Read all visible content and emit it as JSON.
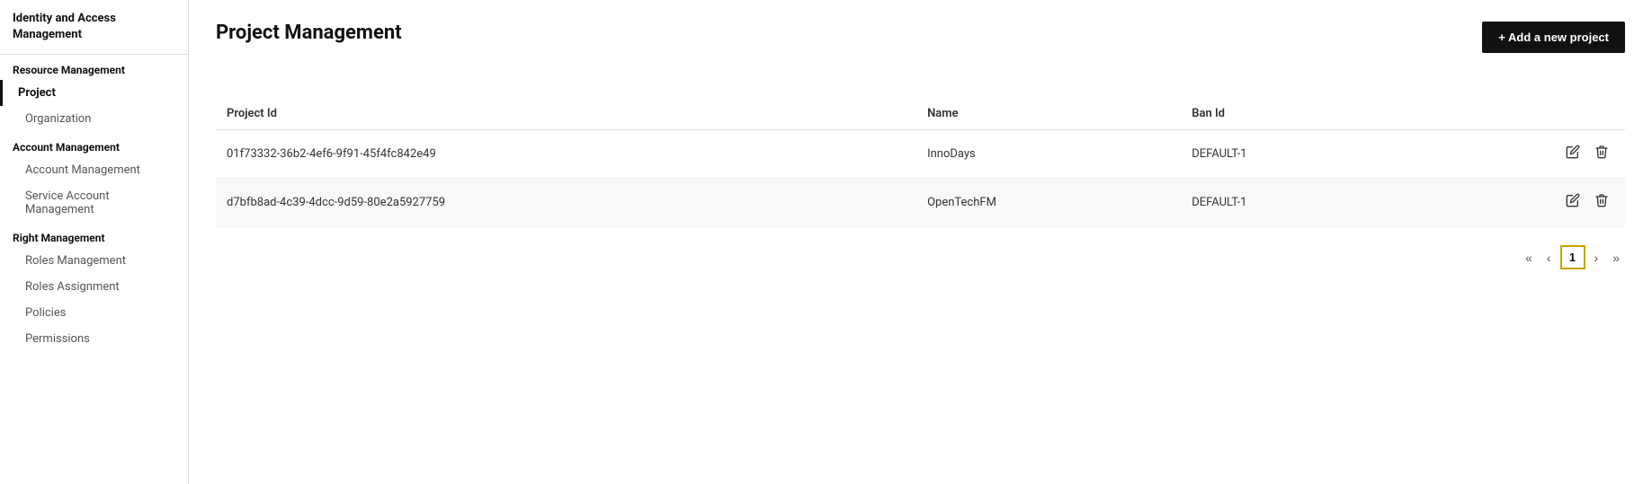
{
  "sidebar": {
    "header": "Identity and Access Management",
    "sections": [
      {
        "label": "Resource Management",
        "items": [
          {
            "id": "project",
            "label": "Project",
            "active": true,
            "sub": false
          },
          {
            "id": "organization",
            "label": "Organization",
            "active": false,
            "sub": true
          }
        ]
      },
      {
        "label": "Account Management",
        "items": [
          {
            "id": "account-management",
            "label": "Account Management",
            "active": false,
            "sub": true
          },
          {
            "id": "service-account-management",
            "label": "Service Account Management",
            "active": false,
            "sub": true
          }
        ]
      },
      {
        "label": "Right Management",
        "items": [
          {
            "id": "roles-management",
            "label": "Roles Management",
            "active": false,
            "sub": true
          },
          {
            "id": "roles-assignment",
            "label": "Roles Assignment",
            "active": false,
            "sub": true
          },
          {
            "id": "policies",
            "label": "Policies",
            "active": false,
            "sub": true
          },
          {
            "id": "permissions",
            "label": "Permissions",
            "active": false,
            "sub": true
          }
        ]
      }
    ]
  },
  "main": {
    "title": "Project Management",
    "add_button_label": "+ Add a new project",
    "table": {
      "columns": [
        {
          "id": "project-id",
          "label": "Project Id"
        },
        {
          "id": "name",
          "label": "Name"
        },
        {
          "id": "ban-id",
          "label": "Ban Id"
        }
      ],
      "rows": [
        {
          "project_id": "01f73332-36b2-4ef6-9f91-45f4fc842e49",
          "name": "InnoDays",
          "ban_id": "DEFAULT-1"
        },
        {
          "project_id": "d7bfb8ad-4c39-4dcc-9d59-80e2a5927759",
          "name": "OpenTechFM",
          "ban_id": "DEFAULT-1"
        }
      ]
    },
    "pagination": {
      "first_label": "«",
      "prev_label": "‹",
      "current_page": "1",
      "next_label": "›",
      "last_label": "»"
    }
  }
}
